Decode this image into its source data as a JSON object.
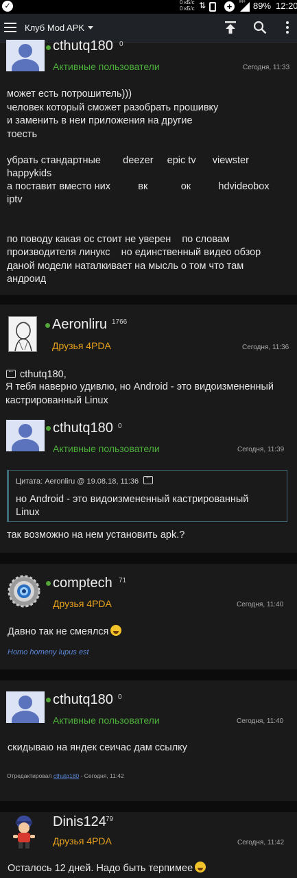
{
  "status_bar": {
    "speed_up": "0 кБ/с",
    "speed_down": "0 кБ/с",
    "battery": "89%",
    "time": "12:20"
  },
  "app_bar": {
    "title": "Клуб Mod APK"
  },
  "posts": [
    {
      "nick": "cthutq180",
      "rep": "0",
      "group": "Активные пользователи",
      "time": "Сегодня, 11:33",
      "lines": [
        "может есть потрошитель)))",
        "человек который сможет разобрать прошивку",
        "и заменить в неи приложения на другие",
        "тоесть",
        "убрать стандартные        deezer     epic tv      viewster",
        "happykids",
        "а поставит вместо них          вк            ок          hdvideobox",
        "iptv",
        "по поводу какая ос стоит не уверен    по словам",
        "производителя линукс    но единственный видео обзор",
        "даной модели наталкивает на мысль о том что там",
        "андроид"
      ]
    },
    {
      "nick": "Aeronliru",
      "rep": "1766",
      "group": "Друзья 4PDA",
      "time": "Сегодня, 11:36",
      "reply_to": "cthutq180,",
      "lines": [
        "Я тебя наверно удивлю, но Android - это видоизмененный",
        "кастрированный Linux"
      ]
    },
    {
      "nick": "cthutq180",
      "rep": "0",
      "group": "Активные пользователи",
      "time": "Сегодня, 11:39",
      "quote_head": "Цитата: Aeronliru @ 19.08.18, 11:36",
      "quote_lines": [
        "но Android - это видоизмененный кастрированный",
        "Linux"
      ],
      "lines": [
        "так возможно на нем установить apk.?"
      ]
    },
    {
      "nick": "comptech",
      "rep": "71",
      "group": "Друзья 4PDA",
      "time": "Сегодня, 11:40",
      "lines": [
        "Давно так не смеялся"
      ],
      "signature": "Homo homeny lupus est"
    },
    {
      "nick": "cthutq180",
      "rep": "0",
      "group": "Активные пользователи",
      "time": "Сегодня, 11:40",
      "lines": [
        "скидываю на яндек сеичас дам ссылку"
      ],
      "edited_prefix": "Отредактировал",
      "edited_by": "cthutq180",
      "edited_suffix": " - Сегодня, 11:42"
    },
    {
      "nick": "Dinis124",
      "rep": "79",
      "group": "Друзья 4PDA",
      "time": "Сегодня, 11:42",
      "lines": [
        "Осталось 12 дней. Надо быть терпимее"
      ]
    }
  ]
}
